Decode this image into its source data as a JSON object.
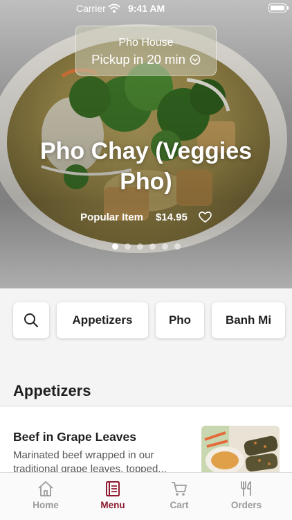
{
  "status": {
    "carrier": "Carrier",
    "time": "9:41 AM"
  },
  "pickup": {
    "store": "Pho House",
    "time_text": "Pickup in 20 min"
  },
  "hero": {
    "title": "Pho Chay (Veggies Pho)",
    "badge": "Popular Item",
    "price": "$14.95",
    "slide_count": 6,
    "active_slide": 1
  },
  "categories": {
    "items": [
      "Appetizers",
      "Pho",
      "Banh Mi"
    ]
  },
  "section": {
    "title": "Appetizers"
  },
  "menu_items": [
    {
      "name": "Beef in Grape Leaves",
      "description": "Marinated beef wrapped in our traditional grape leaves, topped..."
    }
  ],
  "tabs": [
    {
      "label": "Home",
      "icon": "home-icon",
      "active": false
    },
    {
      "label": "Menu",
      "icon": "menu-book-icon",
      "active": true
    },
    {
      "label": "Cart",
      "icon": "cart-icon",
      "active": false
    },
    {
      "label": "Orders",
      "icon": "fork-knife-icon",
      "active": false
    }
  ],
  "colors": {
    "accent": "#8e1a2e",
    "tab_inactive": "#9a9a9a",
    "text": "#1f1f1f"
  }
}
